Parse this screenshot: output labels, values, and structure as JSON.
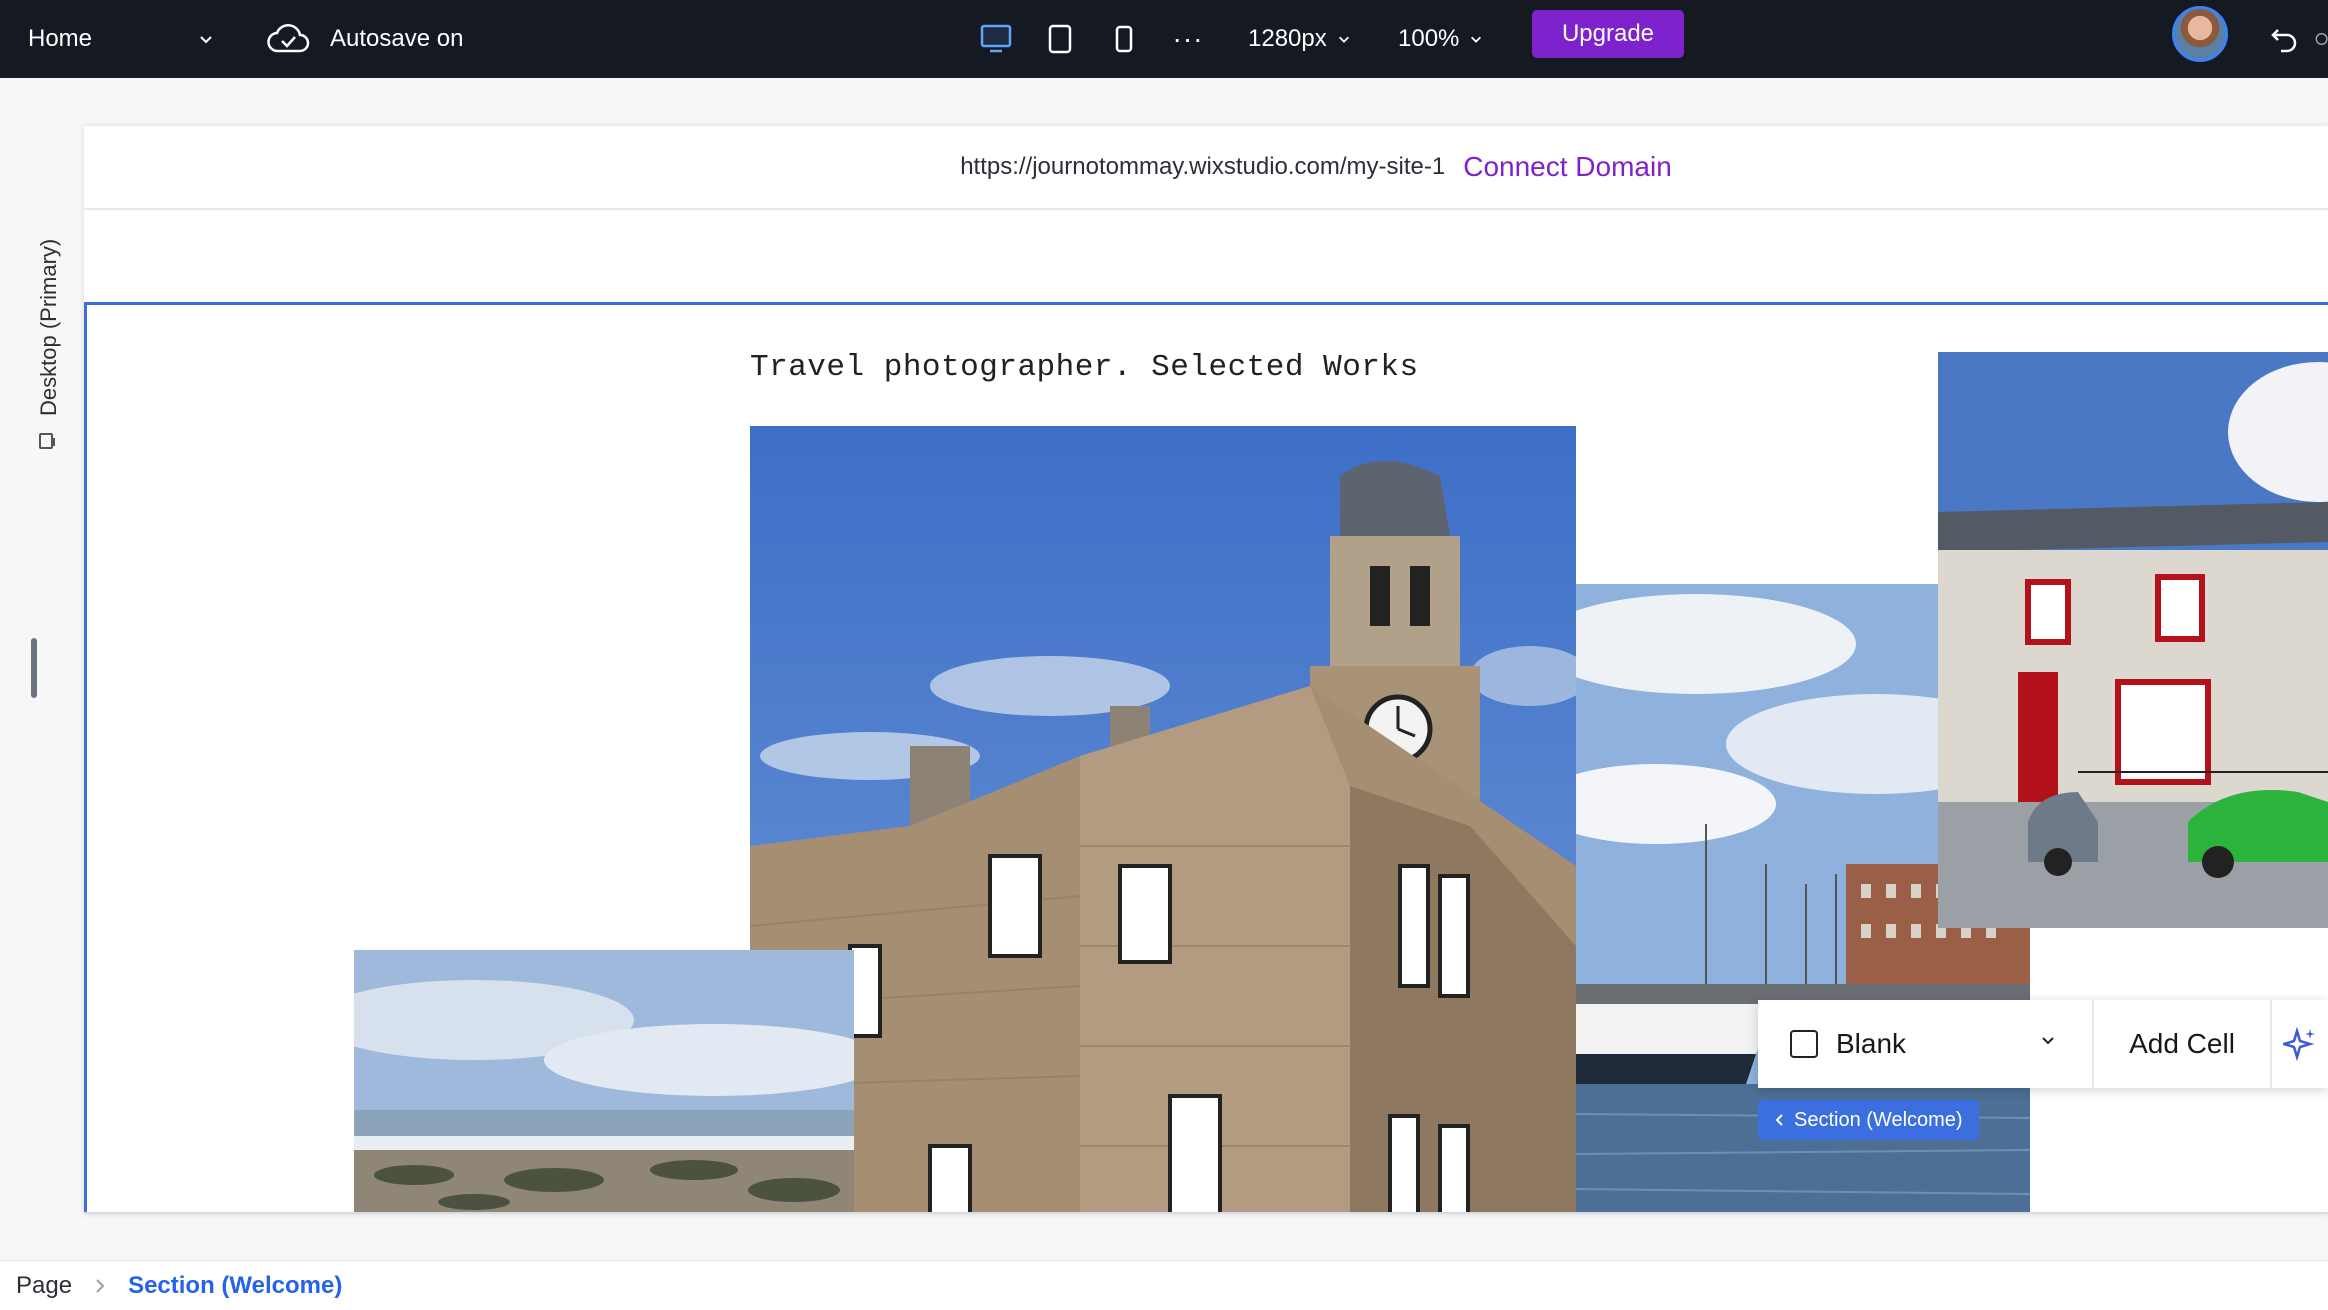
{
  "topbar": {
    "page_name": "Home",
    "autosave_label": "Autosave on",
    "width_value": "1280px",
    "zoom_value": "100%",
    "more_label": "···",
    "upgrade_label": "Upgrade",
    "icons": [
      "cloud-check-icon",
      "desktop-icon",
      "tablet-icon",
      "mobile-icon",
      "more-icon",
      "undo-icon"
    ]
  },
  "sidebar": {
    "breakpoint_label": "Desktop (Primary)"
  },
  "canvas": {
    "site_url": "https://journotommay.wixstudio.com/my-site-1",
    "connect_domain_label": "Connect Domain",
    "headline": "Travel photographer. Selected Works"
  },
  "floating_toolbar": {
    "layout_label": "Blank",
    "add_cell_label": "Add Cell",
    "section_tag": "Section (Welcome)"
  },
  "breadcrumb": {
    "root": "Page",
    "current": "Section (Welcome)"
  },
  "colors": {
    "topbar_bg": "#151922",
    "accent_purple": "#7e22ce",
    "selection_blue": "#3b6fe0",
    "breadcrumb_active": "#2563eb"
  }
}
